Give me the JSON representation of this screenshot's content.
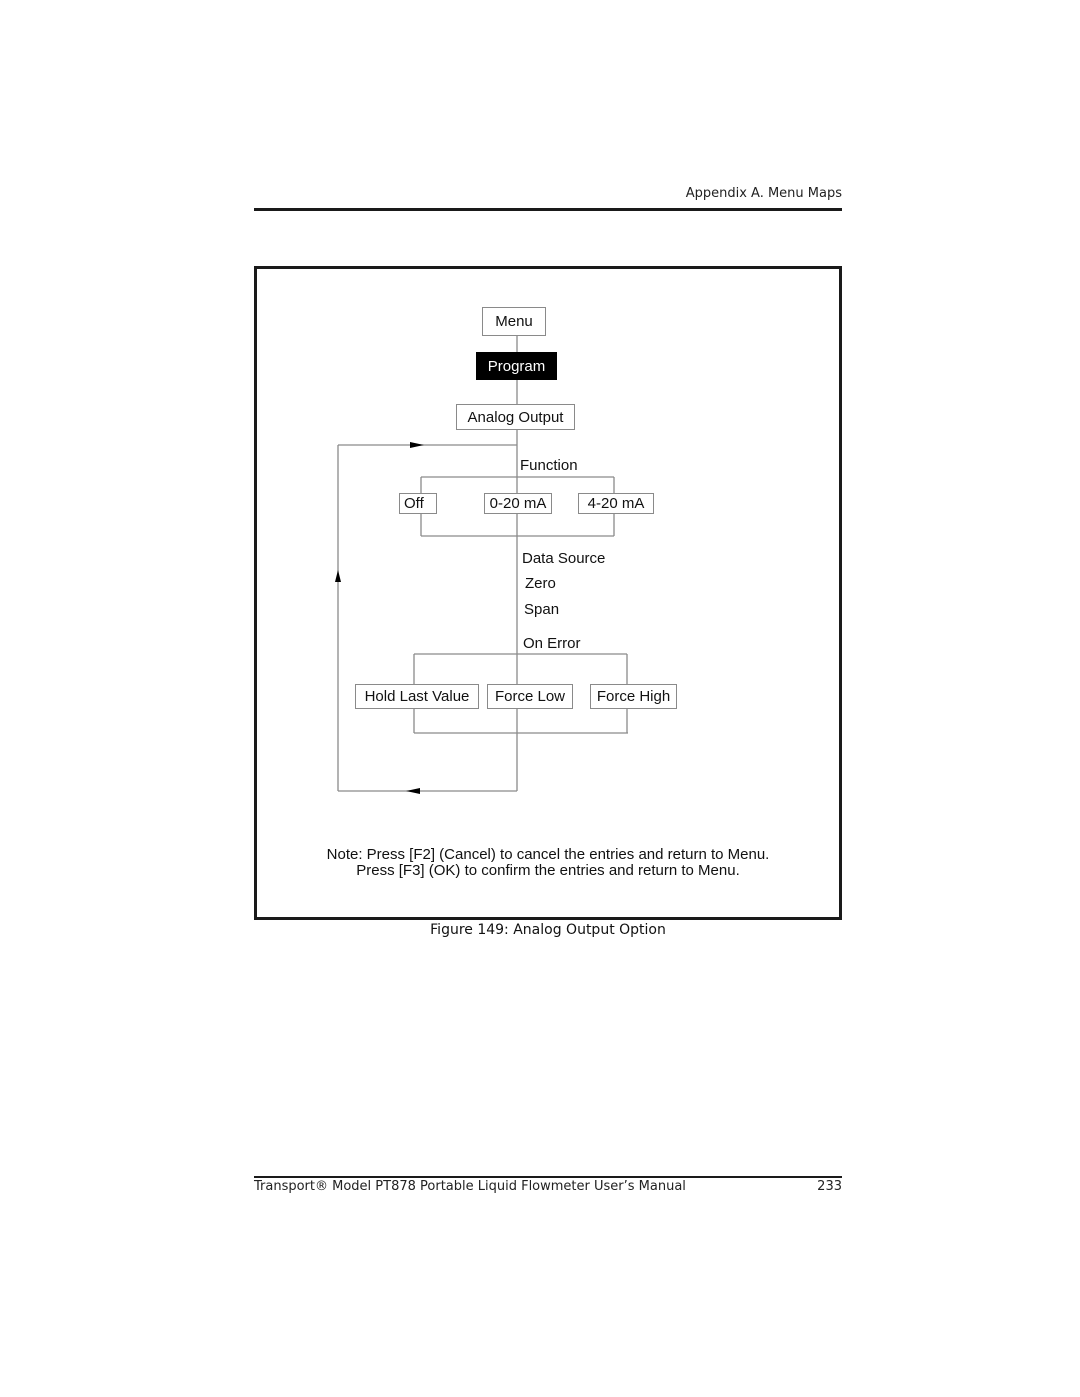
{
  "header": {
    "section": "Appendix A. Menu Maps"
  },
  "diagram": {
    "root": "Menu",
    "selected": "Program",
    "option": "Analog Output",
    "function_label": "Function",
    "function_options": [
      "Off",
      "0-20 mA",
      "4-20 mA"
    ],
    "steps": [
      "Data Source",
      "Zero",
      "Span"
    ],
    "on_error_label": "On Error",
    "error_options": [
      "Hold Last Value",
      "Force Low",
      "Force High"
    ],
    "note_line1": "Note: Press [F2] (Cancel) to cancel the entries and return to Menu.",
    "note_line2": "Press [F3] (OK) to confirm the entries and return to Menu."
  },
  "caption": "Figure 149: Analog Output Option",
  "footer": {
    "title": "Transport® Model PT878 Portable Liquid Flowmeter User’s Manual",
    "page": "233"
  }
}
